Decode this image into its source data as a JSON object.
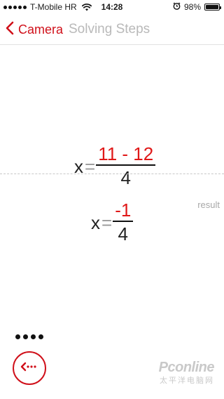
{
  "status_bar": {
    "carrier": "T-Mobile HR",
    "time": "14:28",
    "battery": "98%",
    "battery_level": 0.98,
    "signal_bars": 5,
    "icons": [
      "signal-icon",
      "wifi-icon",
      "alarm-icon",
      "battery-icon"
    ]
  },
  "nav": {
    "back_label": "Camera",
    "title": "Solving Steps",
    "back_icon": "chevron-left-icon"
  },
  "equation_step": {
    "variable": "x",
    "equals": "=",
    "numerator": "11 - 12",
    "denominator": "4"
  },
  "equation_result": {
    "variable": "x",
    "equals": "=",
    "numerator": "-1",
    "denominator": "4"
  },
  "result_label": "result",
  "pager": {
    "dot_count": 4
  },
  "steps_button": {
    "icon": "dotted-back-arrow-icon"
  },
  "watermark": {
    "main": "Pconline",
    "sub": "太平洋电脑网"
  },
  "colors": {
    "accent": "#d0101a",
    "highlight": "#e01818",
    "muted": "#b9b9b9"
  }
}
